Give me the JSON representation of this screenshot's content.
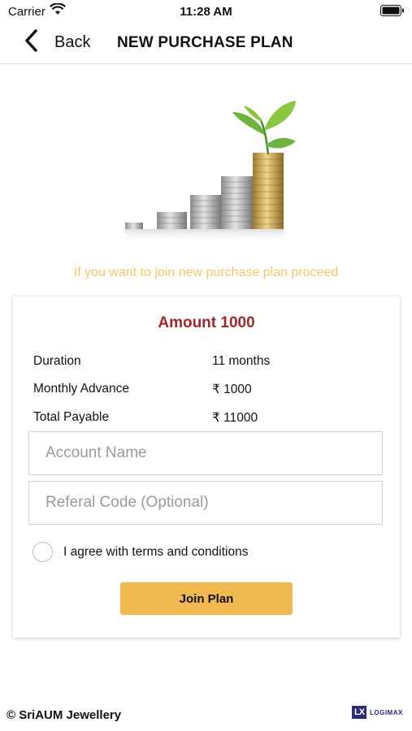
{
  "status_bar": {
    "carrier": "Carrier",
    "time": "11:28 AM"
  },
  "nav": {
    "back_label": "Back",
    "title": "NEW PURCHASE PLAN"
  },
  "intro_text": "If you want to join new purchase plan proceed",
  "plan": {
    "amount_title": "Amount 1000",
    "rows": [
      {
        "label": "Duration",
        "value": "11 months"
      },
      {
        "label": "Monthly Advance",
        "value": "₹ 1000"
      },
      {
        "label": "Total Payable",
        "value": "₹ 11000"
      }
    ]
  },
  "form": {
    "account_name_placeholder": "Account Name",
    "referral_placeholder": "Referal Code (Optional)",
    "agree_label": "I agree with terms and conditions",
    "agree_checked": false,
    "join_button": "Join Plan"
  },
  "footer": {
    "copyright": "© SriAUM Jewellery",
    "logo_mark": "LX",
    "logo_word": "LOGIMAX"
  },
  "colors": {
    "accent": "#f0b94f",
    "amount_title": "#a0282c",
    "intro_text": "#f2c766",
    "logo": "#2b2b7c"
  },
  "icons": {
    "back": "chevron-left-icon",
    "wifi": "wifi-icon",
    "battery": "battery-icon",
    "hero": "coin-stacks-plant-icon"
  }
}
